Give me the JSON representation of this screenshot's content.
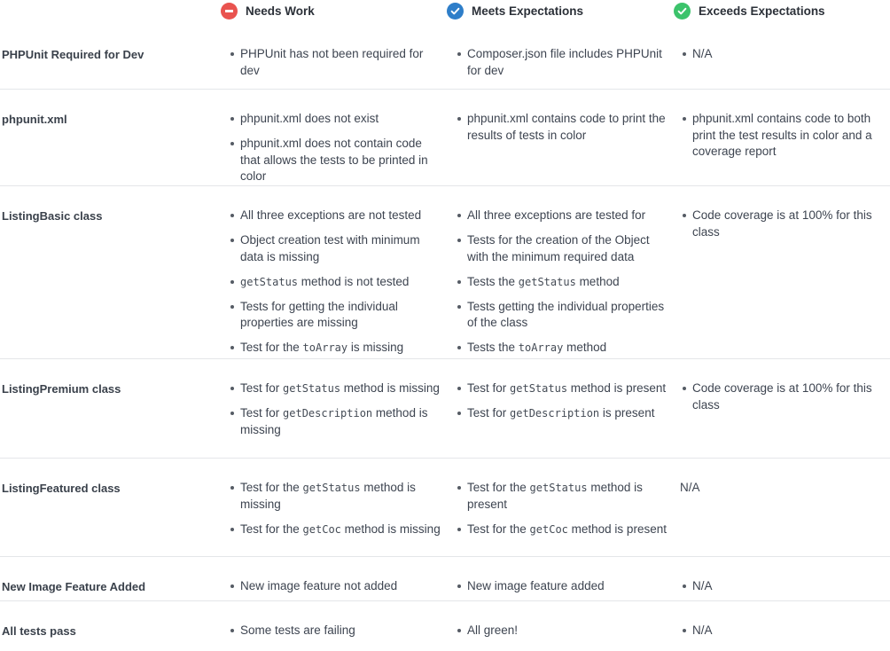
{
  "columns": {
    "needs": "Needs Work",
    "meets": "Meets Expectations",
    "exceeds": "Exceeds Expectations"
  },
  "colors": {
    "needs": "#e9534f",
    "meets": "#2e7ec9",
    "exceeds": "#3cc36b"
  },
  "icons": {
    "needs": "minus-circle-icon",
    "meets": "check-circle-icon",
    "exceeds": "check-circle-icon"
  },
  "rows": [
    {
      "criteria": "PHPUnit Required for Dev",
      "needs": [
        [
          "PHPUnit has not been required for dev"
        ]
      ],
      "meets": [
        [
          "Composer.json file includes PHPUnit for dev"
        ]
      ],
      "exceeds": [
        [
          "N/A"
        ]
      ]
    },
    {
      "criteria": "phpunit.xml",
      "needs": [
        [
          "phpunit.xml does not exist"
        ],
        [
          "phpunit.xml does not contain code that allows the tests to be printed in color"
        ]
      ],
      "meets": [
        [
          "phpunit.xml contains code to print the results of tests in color"
        ]
      ],
      "exceeds": [
        [
          "phpunit.xml contains code to both print the test results in color and a coverage report"
        ]
      ]
    },
    {
      "criteria": "ListingBasic class",
      "needs": [
        [
          "All three exceptions are not tested"
        ],
        [
          "Object creation test with minimum data is missing"
        ],
        [
          {
            "code": "getStatus"
          },
          " method is not tested"
        ],
        [
          "Tests for getting the individual properties are missing"
        ],
        [
          "Test for the ",
          {
            "code": "toArray"
          },
          " is missing"
        ]
      ],
      "meets": [
        [
          "All three exceptions are tested for"
        ],
        [
          "Tests for the creation of the Object with the minimum required data"
        ],
        [
          "Tests the ",
          {
            "code": "getStatus"
          },
          " method"
        ],
        [
          "Tests getting the individual properties of the class"
        ],
        [
          "Tests the ",
          {
            "code": "toArray"
          },
          " method"
        ]
      ],
      "exceeds": [
        [
          "Code coverage is at 100% for this class"
        ]
      ]
    },
    {
      "criteria": "ListingPremium class",
      "needs": [
        [
          "Test for ",
          {
            "code": "getStatus"
          },
          " method is missing"
        ],
        [
          "Test for ",
          {
            "code": "getDescription"
          },
          " method is missing"
        ]
      ],
      "meets": [
        [
          "Test for ",
          {
            "code": "getStatus"
          },
          " method is present"
        ],
        [
          "Test for ",
          {
            "code": "getDescription"
          },
          " is present"
        ]
      ],
      "exceeds": [
        [
          "Code coverage is at 100% for this class"
        ]
      ]
    },
    {
      "criteria": "ListingFeatured class",
      "needs": [
        [
          "Test for the ",
          {
            "code": "getStatus"
          },
          " method is missing"
        ],
        [
          "Test for the ",
          {
            "code": "getCoc"
          },
          " method is missing"
        ]
      ],
      "meets": [
        [
          "Test for the ",
          {
            "code": "getStatus"
          },
          " method is present"
        ],
        [
          "Test for the ",
          {
            "code": "getCoc"
          },
          " method is present"
        ]
      ],
      "exceeds_plain": "N/A"
    },
    {
      "criteria": "New Image Feature Added",
      "needs": [
        [
          "New image feature not added"
        ]
      ],
      "meets": [
        [
          "New image feature added"
        ]
      ],
      "exceeds": [
        [
          "N/A"
        ]
      ]
    },
    {
      "criteria": "All tests pass",
      "needs": [
        [
          "Some tests are failing"
        ]
      ],
      "meets": [
        [
          "All green!"
        ]
      ],
      "exceeds": [
        [
          "N/A"
        ]
      ]
    }
  ]
}
